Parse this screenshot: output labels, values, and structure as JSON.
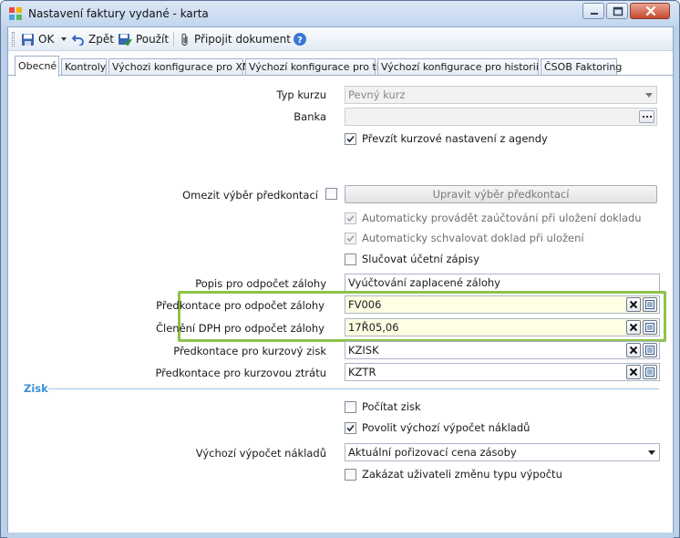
{
  "window": {
    "title": "Nastavení faktury vydané - karta"
  },
  "toolbar": {
    "ok_label": "OK",
    "back_label": "Zpět",
    "apply_label": "Použít",
    "attach_label": "Připojit dokument"
  },
  "tabs": [
    {
      "label": "Obecné",
      "active": true
    },
    {
      "label": "Kontroly"
    },
    {
      "label": "Výchozi konfigurace pro XML"
    },
    {
      "label": "Výchozí konfigurace pro tisk"
    },
    {
      "label": "Výchozí konfigurace pro historii akcí"
    },
    {
      "label": "ČSOB Faktoring"
    }
  ],
  "form": {
    "typ_kurzu": {
      "label": "Typ kurzu",
      "value": "Pevný kurz"
    },
    "banka": {
      "label": "Banka",
      "value": ""
    },
    "prevzit_kurzove": {
      "label": "Převzít kurzové nastavení z agendy",
      "checked": true
    },
    "omezit_vyber": {
      "label": "Omezit výběr předkontací",
      "checked": false
    },
    "upravit_button": "Upravit výběr předkontací",
    "auto_zauctovani": {
      "label": "Automaticky provádět zaúčtování při uložení dokladu",
      "checked": true,
      "disabled": true
    },
    "auto_schvalovat": {
      "label": "Automaticky schvalovat doklad při uložení",
      "checked": true,
      "disabled": true
    },
    "slucovat": {
      "label": "Slučovat účetní zápisy",
      "checked": false
    },
    "popis_odpocet": {
      "label": "Popis pro odpočet zálohy",
      "value": "Vyúčtování zaplacené zálohy"
    },
    "predkontace_odpocet": {
      "label": "Předkontace pro odpočet zálohy",
      "value": "FV006"
    },
    "cleneni_dph": {
      "label": "Členění DPH pro odpočet zálohy",
      "value": "17Ř05,06"
    },
    "predkontace_zisk": {
      "label": "Předkontace pro kurzový zisk",
      "value": "KZISK"
    },
    "predkontace_ztrata": {
      "label": "Předkontace pro kurzovou ztrátu",
      "value": "KZTR"
    }
  },
  "zisk": {
    "section_title": "Zisk",
    "pocitat_zisk": {
      "label": "Počítat zisk",
      "checked": false
    },
    "povolit_vychozi": {
      "label": "Povolit výchozí výpočet nákladů",
      "checked": true
    },
    "vychozi_vypocet": {
      "label": "Výchozí výpočet nákladů",
      "value": "Aktuální pořizovací cena zásoby"
    },
    "zakazat": {
      "label": "Zakázat uživateli změnu typu výpočtu",
      "checked": false
    }
  },
  "colors": {
    "highlight": "#8fc24a",
    "section_title": "#3a8fd6",
    "field_yellow": "#fffde3"
  }
}
